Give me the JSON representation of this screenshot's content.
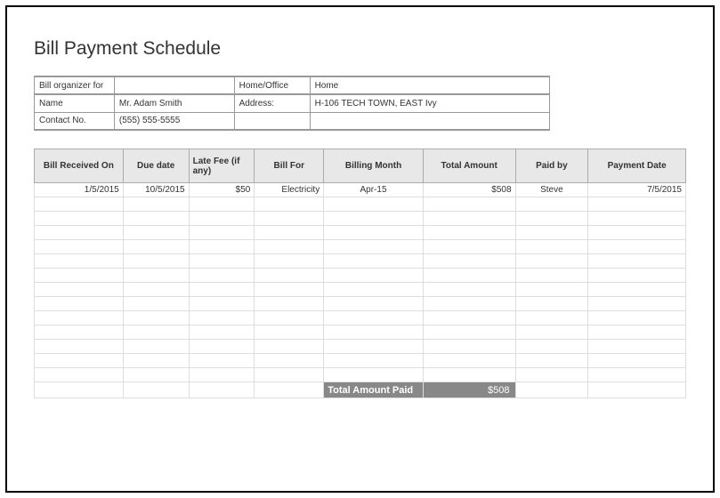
{
  "title": "Bill Payment Schedule",
  "info": {
    "organizer_label": "Bill organizer for",
    "organizer_value": "",
    "homeoffice_label": "Home/Office",
    "homeoffice_value": "Home",
    "name_label": "Name",
    "name_value": "Mr. Adam Smith",
    "address_label": "Address:",
    "address_value": "H-106 TECH TOWN, EAST Ivy",
    "contact_label": "Contact No.",
    "contact_value": "(555) 555-5555"
  },
  "headers": {
    "col1": "Bill Received On",
    "col2": "Due date",
    "col3": "Late Fee (if any)",
    "col4": "Bill For",
    "col5": "Billing Month",
    "col6": "Total Amount",
    "col7": "Paid by",
    "col8": "Payment Date"
  },
  "rows": [
    {
      "received": "1/5/2015",
      "due": "10/5/2015",
      "late_fee": "$50",
      "bill_for": "Electricity",
      "month": "Apr-15",
      "amount": "$508",
      "paid_by": "Steve",
      "payment_date": "7/5/2015"
    }
  ],
  "total": {
    "label": "Total Amount Paid",
    "value": "$508"
  }
}
